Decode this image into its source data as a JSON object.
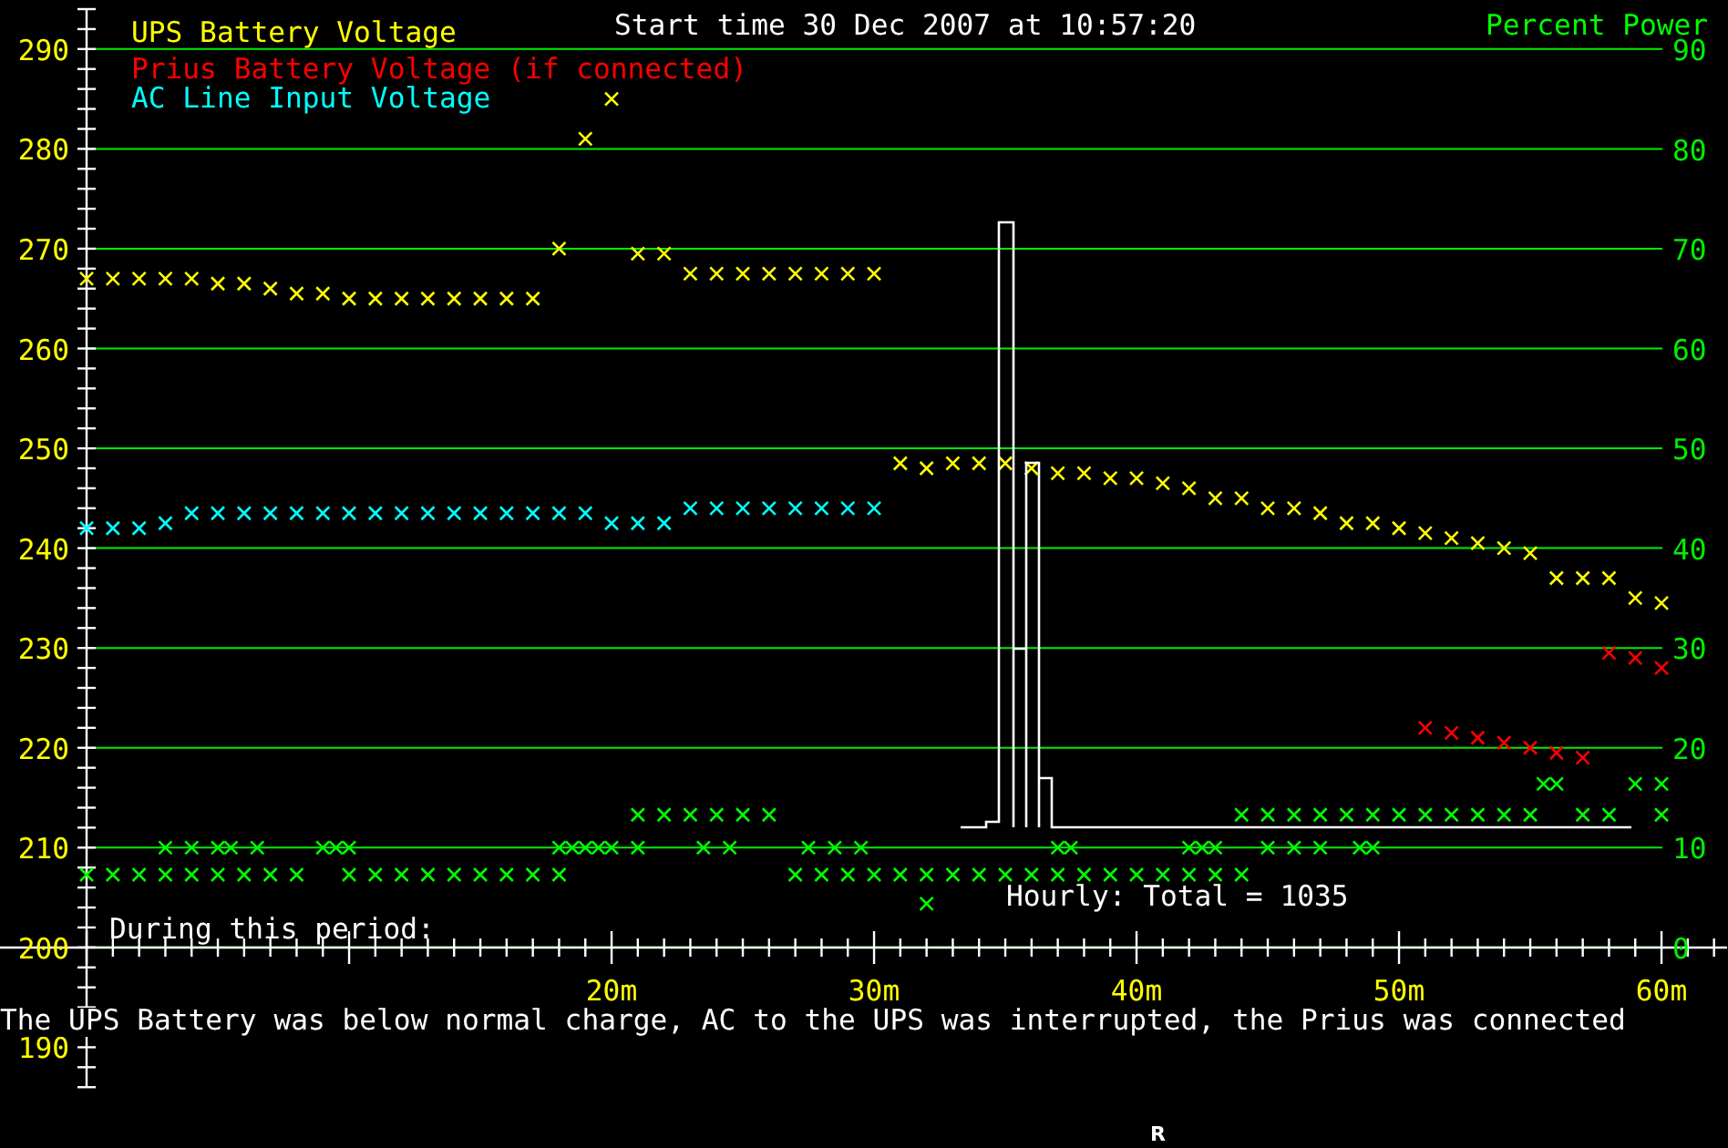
{
  "voltage_chart": {
    "chart_data": {
      "type": "scatter",
      "title": "Start time 30 Dec 2007 at 10:57:20",
      "xlim": [
        -3.3,
        62.5
      ],
      "ylim": [
        186,
        294
      ],
      "grid": true,
      "xticks": [
        {
          "value": 20,
          "label": "20m"
        },
        {
          "value": 30,
          "label": "30m"
        },
        {
          "value": 40,
          "label": "40m"
        },
        {
          "value": 50,
          "label": "50m"
        },
        {
          "value": 60,
          "label": "60m"
        }
      ],
      "yticks": [
        190,
        200,
        210,
        220,
        230,
        240,
        250,
        260,
        270,
        280,
        290
      ],
      "x": [
        0,
        1,
        2,
        3,
        4,
        5,
        6,
        7,
        8,
        9,
        10,
        11,
        12,
        13,
        14,
        15,
        16,
        17,
        18,
        19,
        20,
        21,
        22,
        23,
        24,
        25,
        26,
        27,
        28,
        29,
        30,
        31,
        32,
        33,
        34,
        35,
        36,
        37,
        38,
        39,
        40,
        41,
        42,
        43,
        44,
        45,
        46,
        47,
        48,
        49,
        50,
        51,
        52,
        53,
        54,
        55,
        56,
        57,
        58,
        59,
        60
      ],
      "series": [
        {
          "name": "UPS Battery Voltage",
          "color": "#ffff00",
          "values": [
            267,
            267,
            267,
            267,
            267,
            266.5,
            266.5,
            266,
            265.5,
            265.5,
            265,
            265,
            265,
            265,
            265,
            265,
            265,
            265,
            270,
            281,
            285,
            269.5,
            269.5,
            267.5,
            267.5,
            267.5,
            267.5,
            267.5,
            267.5,
            267.5,
            267.5,
            248.5,
            248,
            248.5,
            248.5,
            248.5,
            248,
            247.5,
            247.5,
            247,
            247,
            246.5,
            246,
            245,
            245,
            244,
            244,
            243.5,
            242.5,
            242.5,
            242,
            241.5,
            241,
            240.5,
            240,
            239.5,
            237,
            237,
            237,
            235,
            234.5
          ]
        },
        {
          "name": "Prius Battery Voltage (if connected)",
          "color": "#ff0000",
          "values": [
            null,
            null,
            null,
            null,
            null,
            null,
            null,
            null,
            null,
            null,
            null,
            null,
            null,
            null,
            null,
            null,
            null,
            null,
            null,
            null,
            null,
            null,
            null,
            null,
            null,
            null,
            null,
            null,
            null,
            null,
            null,
            null,
            null,
            null,
            null,
            null,
            null,
            null,
            null,
            null,
            null,
            null,
            null,
            null,
            null,
            null,
            null,
            null,
            null,
            null,
            null,
            222,
            221.5,
            221,
            220.5,
            220,
            219.5,
            219,
            229.5,
            229,
            228
          ]
        },
        {
          "name": "AC Line Input Voltage",
          "color": "#00ffff",
          "values": [
            242,
            242,
            242,
            242.5,
            243.5,
            243.5,
            243.5,
            243.5,
            243.5,
            243.5,
            243.5,
            243.5,
            243.5,
            243.5,
            243.5,
            243.5,
            243.5,
            243.5,
            243.5,
            243.5,
            242.5,
            242.5,
            242.5,
            244,
            244,
            244,
            244,
            244,
            244,
            244,
            244,
            null,
            null,
            null,
            null,
            null,
            null,
            null,
            null,
            null,
            null,
            null,
            null,
            null,
            null,
            null,
            null,
            null,
            null,
            null,
            null,
            null,
            null,
            null,
            null,
            null,
            null,
            null,
            null,
            null,
            null
          ]
        }
      ]
    }
  },
  "power_chart": {
    "chart_data": {
      "type": "scatter",
      "xlim": [
        -3.3,
        62.5
      ],
      "ylim": [
        0,
        90
      ],
      "yticks": [
        0,
        10,
        20,
        30,
        40,
        50,
        60,
        70,
        80,
        90
      ],
      "x": [
        0,
        1,
        2,
        3,
        4,
        5,
        6,
        7,
        8,
        10,
        11,
        12,
        13,
        14,
        15,
        16,
        17,
        18,
        27,
        28,
        29,
        30,
        31,
        32,
        33,
        34,
        35,
        36,
        37,
        38,
        39,
        40,
        41,
        42,
        43,
        44,
        3,
        4,
        5,
        5.5,
        6.5,
        9,
        9.5,
        10,
        18,
        18.5,
        19,
        19.5,
        20,
        21,
        23.5,
        24.5,
        27.5,
        28.5,
        29.5,
        37,
        37.5,
        42,
        42.5,
        43,
        45,
        46,
        47,
        48.5,
        49,
        21,
        22,
        23,
        24,
        25,
        26,
        44,
        45,
        46,
        47,
        48,
        49,
        50,
        51,
        52,
        53,
        54,
        55,
        57,
        58,
        60,
        55.5,
        56,
        59,
        60,
        32
      ],
      "series": [
        {
          "name": "Percent Power",
          "color": "#00ff00",
          "values": [
            7.3,
            7.3,
            7.3,
            7.3,
            7.3,
            7.3,
            7.3,
            7.3,
            7.3,
            7.3,
            7.3,
            7.3,
            7.3,
            7.3,
            7.3,
            7.3,
            7.3,
            7.3,
            7.3,
            7.3,
            7.3,
            7.3,
            7.3,
            7.3,
            7.3,
            7.3,
            7.3,
            7.3,
            7.3,
            7.3,
            7.3,
            7.3,
            7.3,
            7.3,
            7.3,
            7.3,
            10,
            10,
            10,
            10,
            10,
            10,
            10,
            10,
            10,
            10,
            10,
            10,
            10,
            10,
            10,
            10,
            10,
            10,
            10,
            10,
            10,
            10,
            10,
            10,
            10,
            10,
            10,
            10,
            10,
            13.3,
            13.3,
            13.3,
            13.3,
            13.3,
            13.3,
            13.3,
            13.3,
            13.3,
            13.3,
            13.3,
            13.3,
            13.3,
            13.3,
            13.3,
            13.3,
            13.3,
            13.3,
            13.3,
            13.3,
            13.3,
            16.4,
            16.4,
            16.4,
            16.4,
            4.4
          ]
        }
      ]
    }
  },
  "histogram": {
    "label": "Hourly: Total = 1035"
  },
  "summary": {
    "heading": "During this period:",
    "text": "The UPS Battery was below normal charge, AC to the UPS was interrupted, the Prius was connected"
  },
  "footer_mark": "R"
}
